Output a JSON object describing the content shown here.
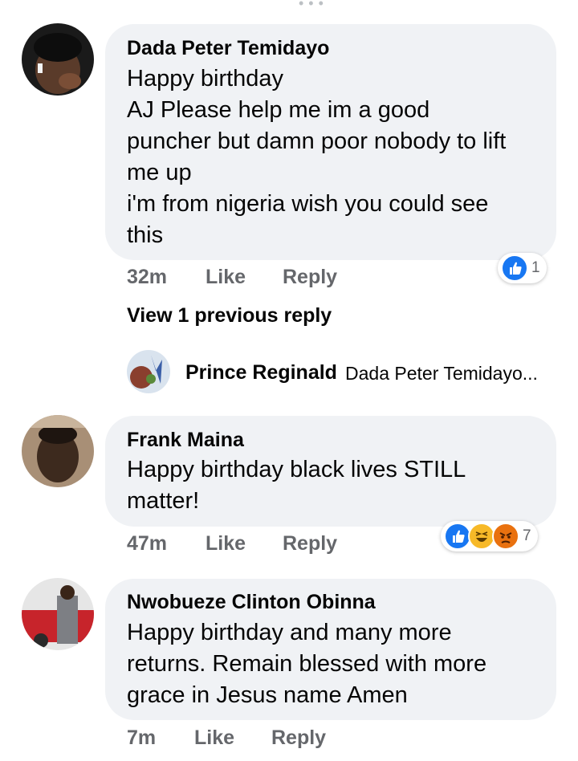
{
  "comments": [
    {
      "author": "Dada Peter Temidayo",
      "text": "Happy birthday\nAJ Please help me im a good\npuncher but damn poor nobody to lift\nme up\ni'm from nigeria wish you could see\nthis",
      "time": "32m",
      "like_label": "Like",
      "reply_label": "Reply",
      "reactions": [
        "like"
      ],
      "reaction_count": "1"
    },
    {
      "author": "Frank Maina",
      "text": "Happy birthday black lives STILL\nmatter!",
      "time": "47m",
      "like_label": "Like",
      "reply_label": "Reply",
      "reactions": [
        "like",
        "haha",
        "angry"
      ],
      "reaction_count": "7"
    },
    {
      "author": "Nwobueze Clinton Obinna",
      "text": "Happy birthday and many more\nreturns. Remain blessed with more\ngrace in Jesus name Amen",
      "time": "7m",
      "like_label": "Like",
      "reply_label": "Reply"
    }
  ],
  "view_previous": "View 1 previous reply",
  "reply_preview": {
    "author": "Prince Reginald",
    "snippet": "Dada Peter Temidayo..."
  },
  "colors": {
    "bubble": "#f0f2f5",
    "meta_text": "#65676b",
    "like_blue": "#1877f2",
    "haha_yellow": "#f7b928",
    "angry_orange": "#e9710f"
  }
}
